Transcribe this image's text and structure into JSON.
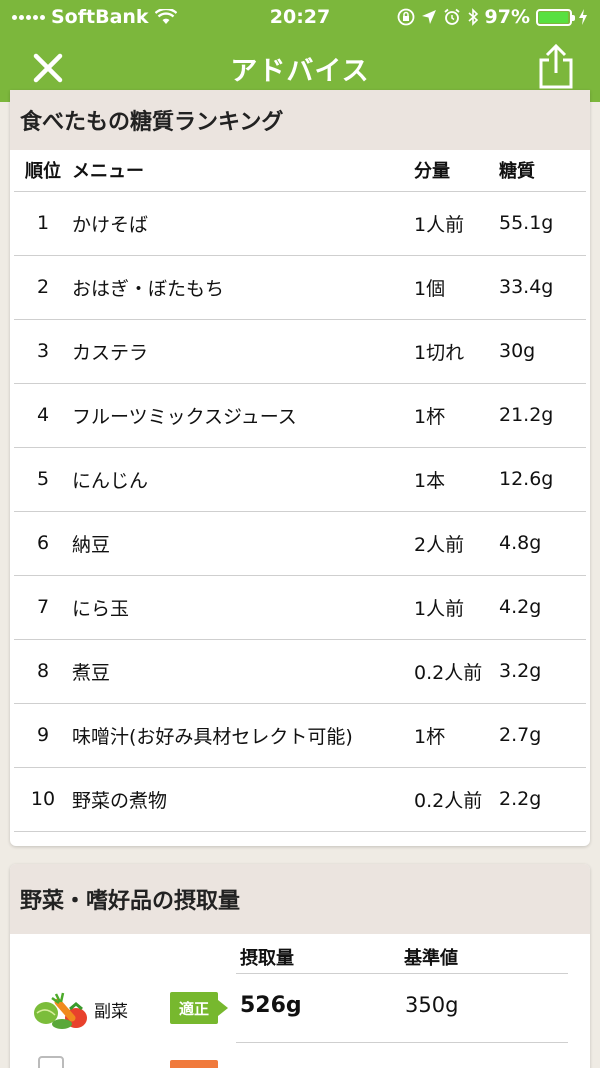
{
  "status_bar": {
    "carrier": "SoftBank",
    "time": "20:27",
    "battery_percent": "97%",
    "battery_level": 0.97
  },
  "nav": {
    "title": "アドバイス",
    "close_icon": "close-icon",
    "share_icon": "share-icon"
  },
  "ranking": {
    "title": "食べたもの糖質ランキング",
    "columns": {
      "rank": "順位",
      "menu": "メニュー",
      "amount": "分量",
      "carbs": "糖質"
    },
    "rows": [
      {
        "rank": "1",
        "menu": "かけそば",
        "amount": "1人前",
        "carbs": "55.1g"
      },
      {
        "rank": "2",
        "menu": "おはぎ・ぼたもち",
        "amount": "1個",
        "carbs": "33.4g"
      },
      {
        "rank": "3",
        "menu": "カステラ",
        "amount": "1切れ",
        "carbs": "30g"
      },
      {
        "rank": "4",
        "menu": "フルーツミックスジュース",
        "amount": "1杯",
        "carbs": "21.2g"
      },
      {
        "rank": "5",
        "menu": "にんじん",
        "amount": "1本",
        "carbs": "12.6g"
      },
      {
        "rank": "6",
        "menu": "納豆",
        "amount": "2人前",
        "carbs": "4.8g"
      },
      {
        "rank": "7",
        "menu": "にら玉",
        "amount": "1人前",
        "carbs": "4.2g"
      },
      {
        "rank": "8",
        "menu": "煮豆",
        "amount": "0.2人前",
        "carbs": "3.2g"
      },
      {
        "rank": "9",
        "menu": "味噌汁(お好み具材セレクト可能)",
        "amount": "1杯",
        "carbs": "2.7g"
      },
      {
        "rank": "10",
        "menu": "野菜の煮物",
        "amount": "0.2人前",
        "carbs": "2.2g"
      }
    ]
  },
  "intake": {
    "title": "野菜・嗜好品の摂取量",
    "columns": {
      "intake": "摂取量",
      "standard": "基準値"
    },
    "rows": [
      {
        "label": "副菜",
        "badge": "適正",
        "intake": "526g",
        "standard": "350g",
        "icon": "vegetable-icon"
      }
    ]
  },
  "colors": {
    "brand_green": "#7cb73c",
    "header_bg": "#ebe4df",
    "badge_ok": "#77b82e",
    "badge_warn": "#f07a3c"
  }
}
